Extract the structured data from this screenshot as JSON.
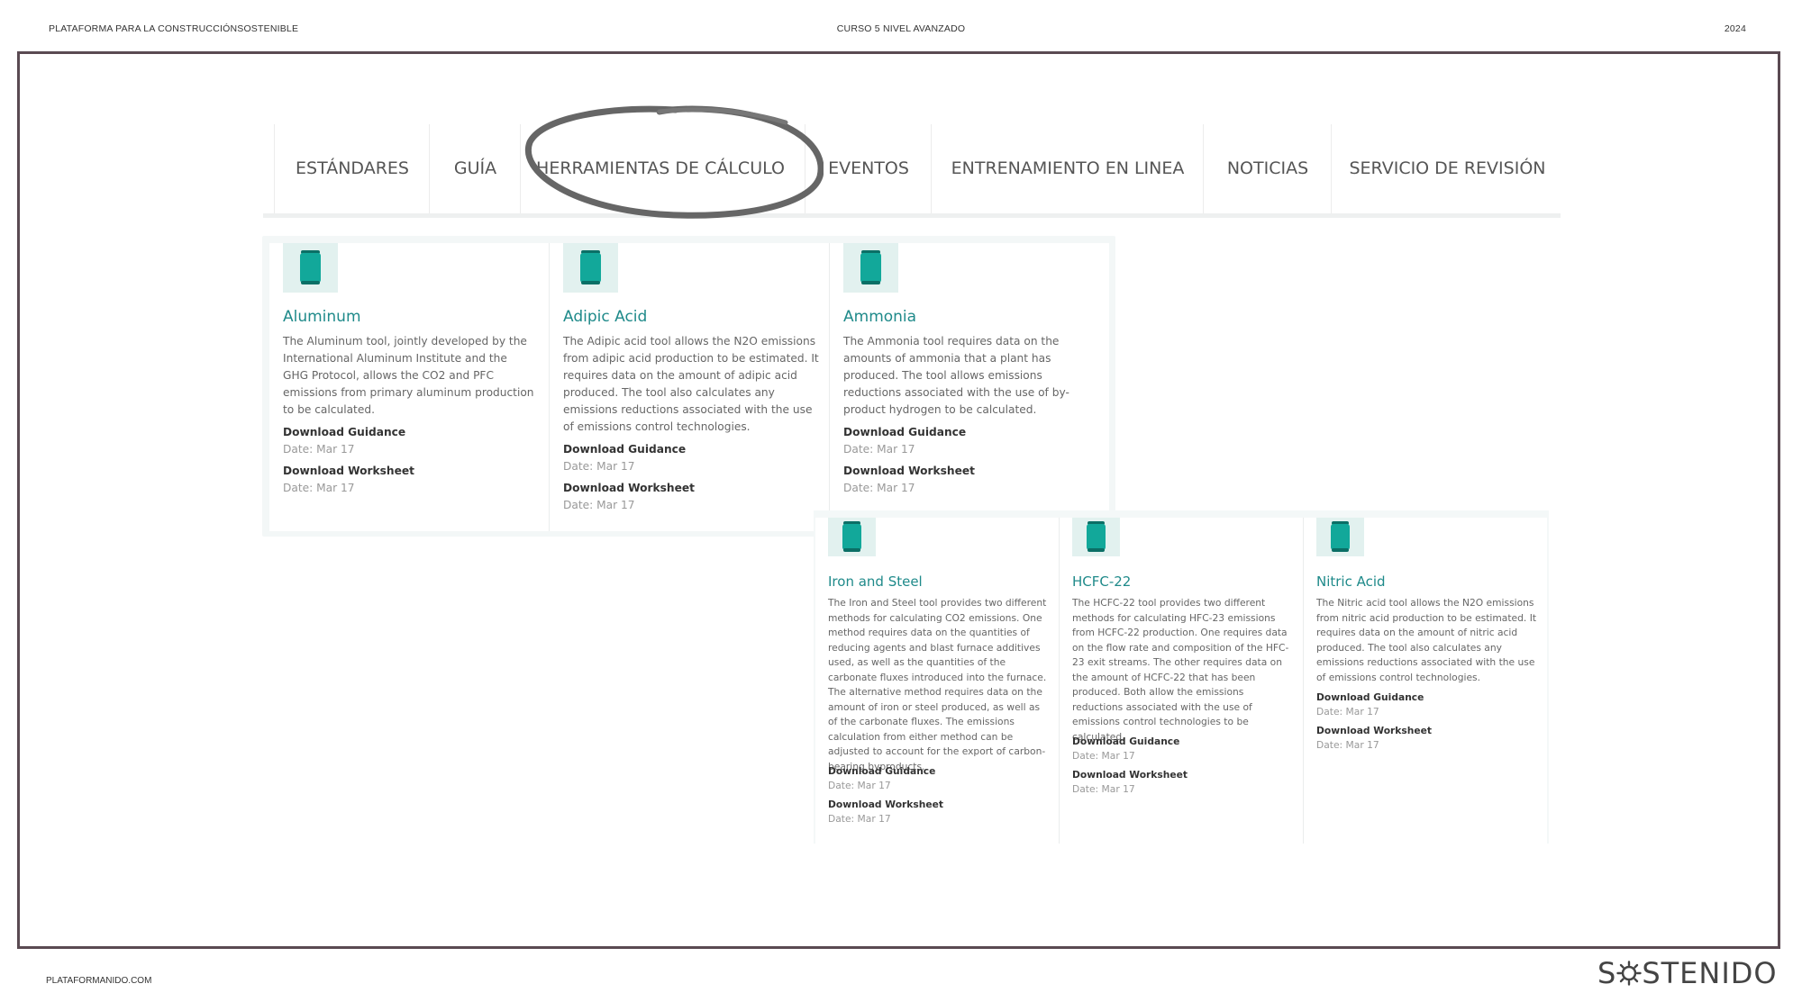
{
  "header": {
    "left": "PLATAFORMA PARA LA CONSTRUCCIÓNSOSTENIBLE",
    "center": "CURSO 5 NIVEL AVANZADO",
    "right": "2024"
  },
  "nav": {
    "items": [
      {
        "label": "ESTÁNDARES"
      },
      {
        "label": "GUÍA"
      },
      {
        "label": "HERRAMIENTAS DE CÁLCULO",
        "highlighted": true
      },
      {
        "label": "EVENTOS"
      },
      {
        "label": "ENTRENAMIENTO EN LINEA"
      },
      {
        "label": "NOTICIAS"
      },
      {
        "label": "SERVICIO DE REVISIÓN"
      }
    ]
  },
  "cards": [
    {
      "title": "Aluminum",
      "description": "The Aluminum tool, jointly developed by the International Aluminum Institute and the GHG Protocol, allows the CO2 and PFC emissions from primary aluminum production to be calculated.",
      "guidance_label": "Download Guidance",
      "guidance_date": "Date: Mar 17",
      "worksheet_label": "Download Worksheet",
      "worksheet_date": "Date: Mar 17",
      "icon": "battery-icon"
    },
    {
      "title": "Adipic Acid",
      "description": "The Adipic acid tool allows the N2O emissions from adipic acid production to be estimated. It requires data on the amount of adipic acid produced. The tool also calculates any emissions reductions associated with the use of emissions control technologies.",
      "guidance_label": "Download Guidance",
      "guidance_date": "Date: Mar 17",
      "worksheet_label": "Download Worksheet",
      "worksheet_date": "Date: Mar 17",
      "icon": "battery-icon"
    },
    {
      "title": "Ammonia",
      "description": "The Ammonia tool requires data on the amounts of ammonia that a plant has produced. The tool allows emissions reductions associated with the use of by-product hydrogen to be calculated.",
      "guidance_label": "Download Guidance",
      "guidance_date": "Date: Mar 17",
      "worksheet_label": "Download Worksheet",
      "worksheet_date": "Date: Mar 17",
      "icon": "battery-icon"
    },
    {
      "title": "Iron and Steel",
      "description": "The Iron and Steel tool provides two different methods for calculating CO2 emissions. One method requires data on the quantities of reducing agents and blast furnace additives used, as well as the quantities of the carbonate fluxes introduced into the furnace. The alternative method requires data on the amount of iron or steel produced, as well as of the carbonate fluxes. The emissions calculation from either method can be adjusted to account for the export of carbon-bearing byproducts.",
      "guidance_label": "Download Guidance",
      "guidance_date": "Date: Mar 17",
      "worksheet_label": "Download Worksheet",
      "worksheet_date": "Date: Mar 17",
      "icon": "battery-icon"
    },
    {
      "title": "HCFC-22",
      "description": "The HCFC-22 tool provides two different methods for calculating HFC-23 emissions from HCFC-22 production. One requires data on the flow rate and composition of the HFC-23 exit streams. The other requires data on the amount of HCFC-22 that has been produced. Both allow the emissions reductions associated with the use of emissions control technologies to be calculated.",
      "guidance_label": "Download Guidance",
      "guidance_date": "Date: Mar 17",
      "worksheet_label": "Download Worksheet",
      "worksheet_date": "Date: Mar 17",
      "icon": "battery-icon"
    },
    {
      "title": "Nitric Acid",
      "description": "The Nitric acid tool allows the N2O emissions from nitric acid production to be estimated. It requires data on the amount of nitric acid produced. The tool also calculates any emissions reductions associated with the use of emissions control technologies.",
      "guidance_label": "Download Guidance",
      "guidance_date": "Date: Mar 17",
      "worksheet_label": "Download Worksheet",
      "worksheet_date": "Date: Mar 17",
      "icon": "battery-icon"
    }
  ],
  "footer": {
    "left": "PLATAFORMANIDO.COM",
    "logo_prefix": "S",
    "logo_suffix": "STENIDO"
  },
  "colors": {
    "accent": "#1f8a8a",
    "icon_fill": "#12a89a",
    "frame": "#5a4a52"
  }
}
